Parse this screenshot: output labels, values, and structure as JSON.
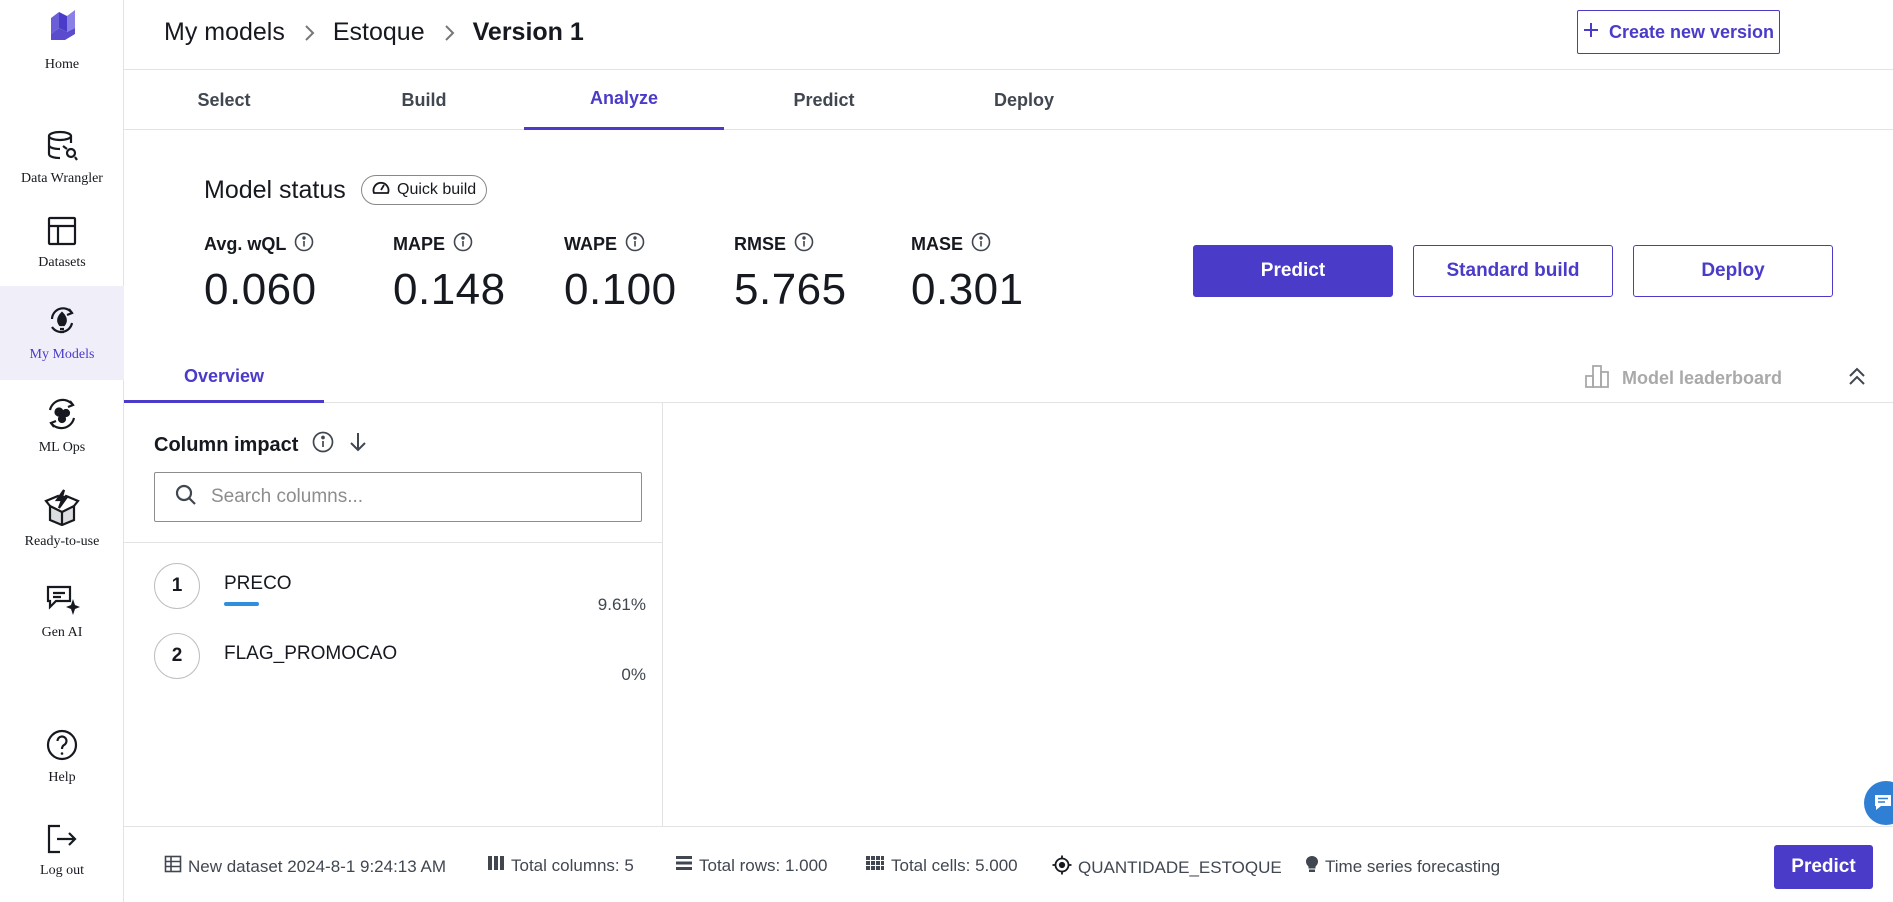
{
  "sidebar": {
    "logo_label": "Home",
    "items": [
      {
        "label": "Data Wrangler",
        "icon": "data-wrangler-icon"
      },
      {
        "label": "Datasets",
        "icon": "datasets-icon"
      },
      {
        "label": "My Models",
        "icon": "my-models-icon",
        "active": true
      },
      {
        "label": "ML Ops",
        "icon": "ml-ops-icon"
      },
      {
        "label": "Ready-to-use",
        "icon": "ready-to-use-icon"
      },
      {
        "label": "Gen AI",
        "icon": "gen-ai-icon"
      },
      {
        "label": "Help",
        "icon": "help-icon"
      },
      {
        "label": "Log out",
        "icon": "logout-icon"
      }
    ]
  },
  "header": {
    "breadcrumb": [
      "My models",
      "Estoque",
      "Version 1"
    ],
    "create_label": "Create new version"
  },
  "tabs": [
    "Select",
    "Build",
    "Analyze",
    "Predict",
    "Deploy"
  ],
  "active_tab": "Analyze",
  "status": {
    "title": "Model status",
    "build_badge": "Quick build",
    "metrics": [
      {
        "label": "Avg. wQL",
        "value": "0.060"
      },
      {
        "label": "MAPE",
        "value": "0.148"
      },
      {
        "label": "WAPE",
        "value": "0.100"
      },
      {
        "label": "RMSE",
        "value": "5.765"
      },
      {
        "label": "MASE",
        "value": "0.301"
      }
    ],
    "actions": {
      "predict": "Predict",
      "standard_build": "Standard build",
      "deploy": "Deploy"
    }
  },
  "subtabs": {
    "overview": "Overview",
    "leaderboard": "Model leaderboard"
  },
  "column_impact": {
    "title": "Column impact",
    "search_placeholder": "Search columns...",
    "columns": [
      {
        "rank": "1",
        "name": "PRECO",
        "impact": "9.61%",
        "impact_fraction": 0.0961
      },
      {
        "rank": "2",
        "name": "FLAG_PROMOCAO",
        "impact": "0%",
        "impact_fraction": 0
      }
    ]
  },
  "footer": {
    "dataset": "New dataset 2024-8-1 9:24:13 AM",
    "total_columns": "Total columns: 5",
    "total_rows": "Total rows: 1.000",
    "total_cells": "Total cells: 5.000",
    "target": "QUANTIDADE_ESTOQUE",
    "model_type": "Time series forecasting",
    "predict_label": "Predict"
  },
  "colors": {
    "accent": "#4a3bc9",
    "impact_bar": "#2f8fdd"
  }
}
